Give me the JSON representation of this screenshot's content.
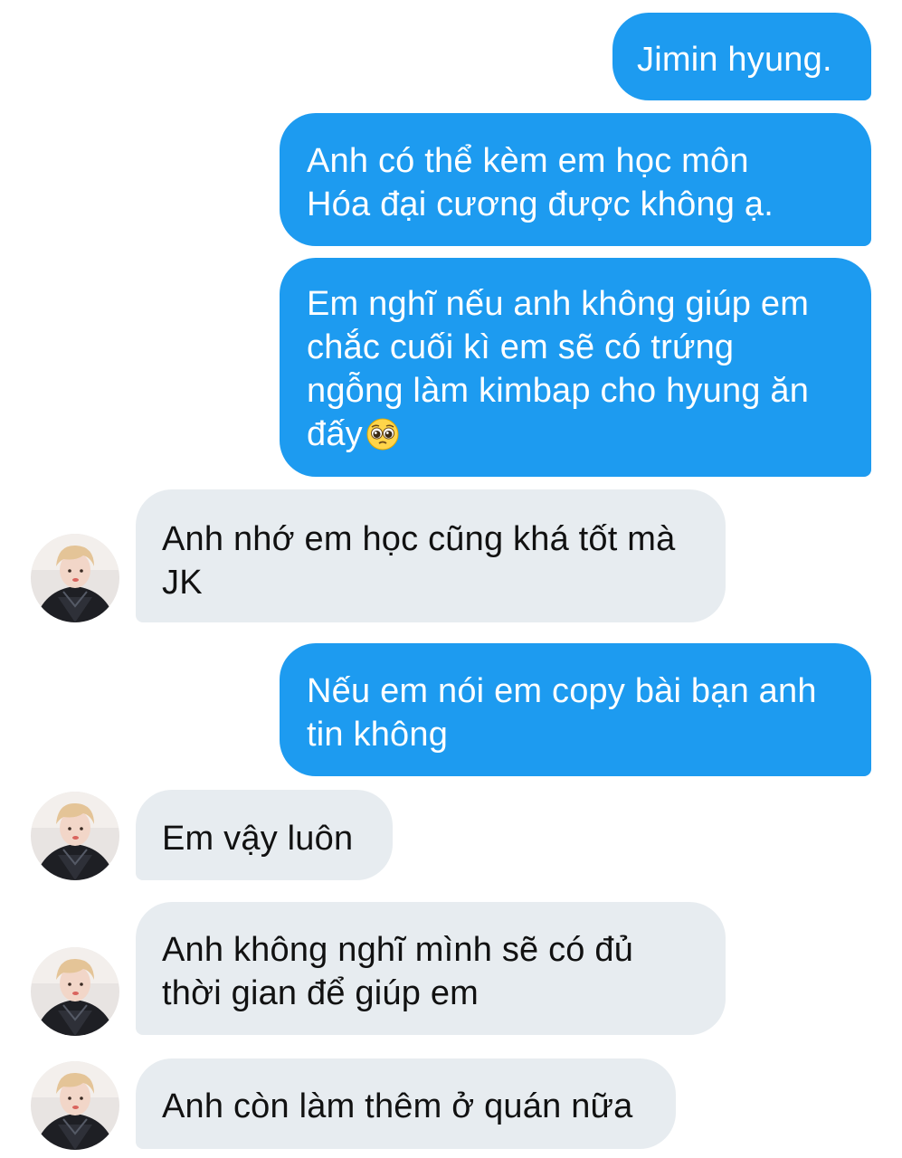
{
  "colors": {
    "sent_bubble": "#1D9BF0",
    "received_bubble": "#E7ECF0",
    "sent_text": "#FFFFFF",
    "received_text": "#111111"
  },
  "messages": [
    {
      "direction": "sent",
      "lines": [
        "Jimin hyung."
      ]
    },
    {
      "direction": "sent",
      "lines": [
        "Anh có thể kèm em học môn",
        "Hóa đại cương được không ạ."
      ]
    },
    {
      "direction": "sent",
      "lines": [
        "Em nghĩ nếu anh không giúp em",
        "chắc cuối kì em sẽ có trứng",
        "ngỗng làm kimbap cho hyung ăn",
        "đấy"
      ],
      "emoji": "pleading-face-emoji"
    },
    {
      "direction": "received",
      "lines": [
        "Anh nhớ em học cũng khá tốt mà",
        "JK"
      ]
    },
    {
      "direction": "sent",
      "lines": [
        "Nếu em nói em copy bài bạn anh",
        "tin không"
      ]
    },
    {
      "direction": "received",
      "lines": [
        "Em vậy luôn"
      ]
    },
    {
      "direction": "received",
      "lines": [
        "Anh không nghĩ mình sẽ có đủ",
        "thời gian để giúp em"
      ]
    },
    {
      "direction": "received",
      "lines": [
        "Anh còn làm thêm ở quán nữa"
      ]
    }
  ]
}
